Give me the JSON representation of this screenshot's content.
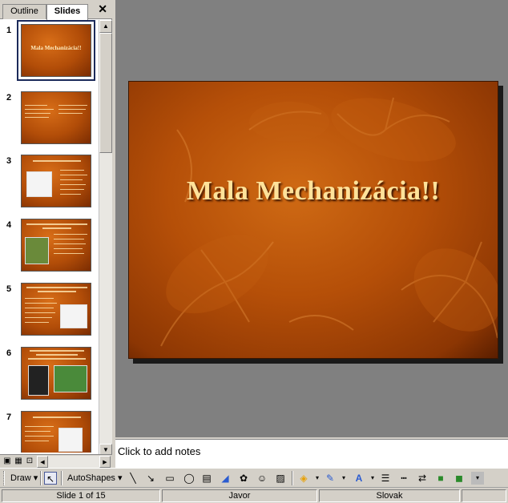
{
  "left_pane": {
    "tabs": [
      {
        "label": "Outline"
      },
      {
        "label": "Slides"
      }
    ],
    "close_glyph": "✕",
    "slides": [
      {
        "number": "1",
        "title": "Mala Mechanizácia!!"
      },
      {
        "number": "2",
        "title": ""
      },
      {
        "number": "3",
        "title": ""
      },
      {
        "number": "4",
        "title": ""
      },
      {
        "number": "5",
        "title": ""
      },
      {
        "number": "6",
        "title": ""
      },
      {
        "number": "7",
        "title": ""
      }
    ]
  },
  "main": {
    "slide_title": "Mala Mechanizácia!!",
    "notes_placeholder": "Click to add notes",
    "theme_colors": {
      "slide_bg": "#b54f08",
      "title": "#ffe29a",
      "workspace": "#808080"
    }
  },
  "draw_toolbar": {
    "draw_label": "Draw",
    "autoshapes_label": "AutoShapes",
    "icons": [
      "select-pointer-icon",
      "line-icon",
      "arrow-icon",
      "rectangle-icon",
      "oval-icon",
      "text-box-icon",
      "wordart-icon",
      "diagram-icon",
      "clip-art-icon",
      "picture-icon",
      "fill-color-icon",
      "line-color-icon",
      "font-color-icon",
      "line-style-icon",
      "dash-style-icon",
      "arrow-style-icon",
      "shadow-icon",
      "3d-style-icon"
    ]
  },
  "status_bar": {
    "slide_indicator": "Slide 1 of 15",
    "design_template": "Javor",
    "language": "Slovak"
  }
}
